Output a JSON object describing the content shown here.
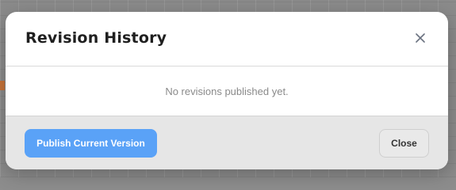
{
  "dialog": {
    "title": "Revision History",
    "close_icon": "close-icon",
    "empty_message": "No revisions published yet.",
    "publish_label": "Publish Current Version",
    "close_label": "Close"
  },
  "colors": {
    "primary": "#5aa2f7",
    "footer_bg": "#e6e6e6"
  }
}
